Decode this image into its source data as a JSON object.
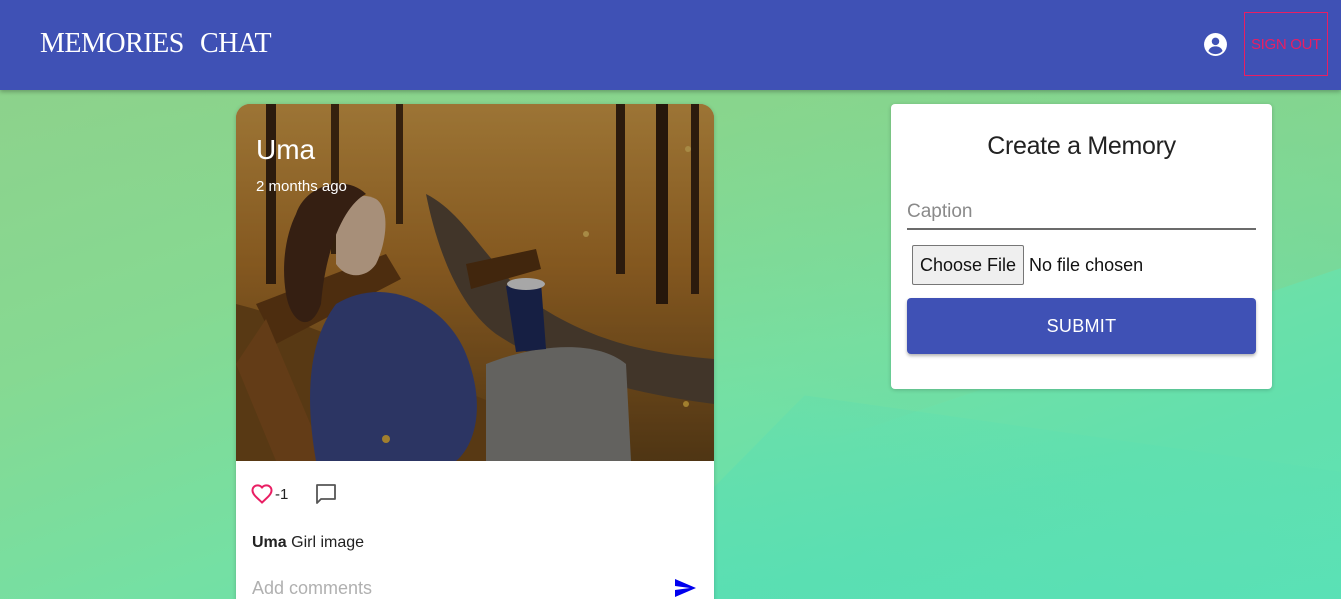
{
  "appbar": {
    "nav": [
      "MEMORIES",
      "CHAT"
    ],
    "account_icon": "account-circle-icon",
    "signout_label": "SIGN OUT",
    "color": "#3f51b5",
    "signout_color": "#e91e63"
  },
  "post": {
    "author": "Uma",
    "time": "2 months ago",
    "like_icon": "heart-outline-icon",
    "like_count": "-1",
    "comment_icon": "comment-icon",
    "caption_author": "Uma",
    "caption_text": "Girl image",
    "comment_placeholder": "Add comments",
    "send_icon": "send-icon"
  },
  "form": {
    "title": "Create a Memory",
    "caption_placeholder": "Caption",
    "file_button": "Choose File",
    "file_status": "No file chosen",
    "submit_label": "SUBMIT"
  }
}
